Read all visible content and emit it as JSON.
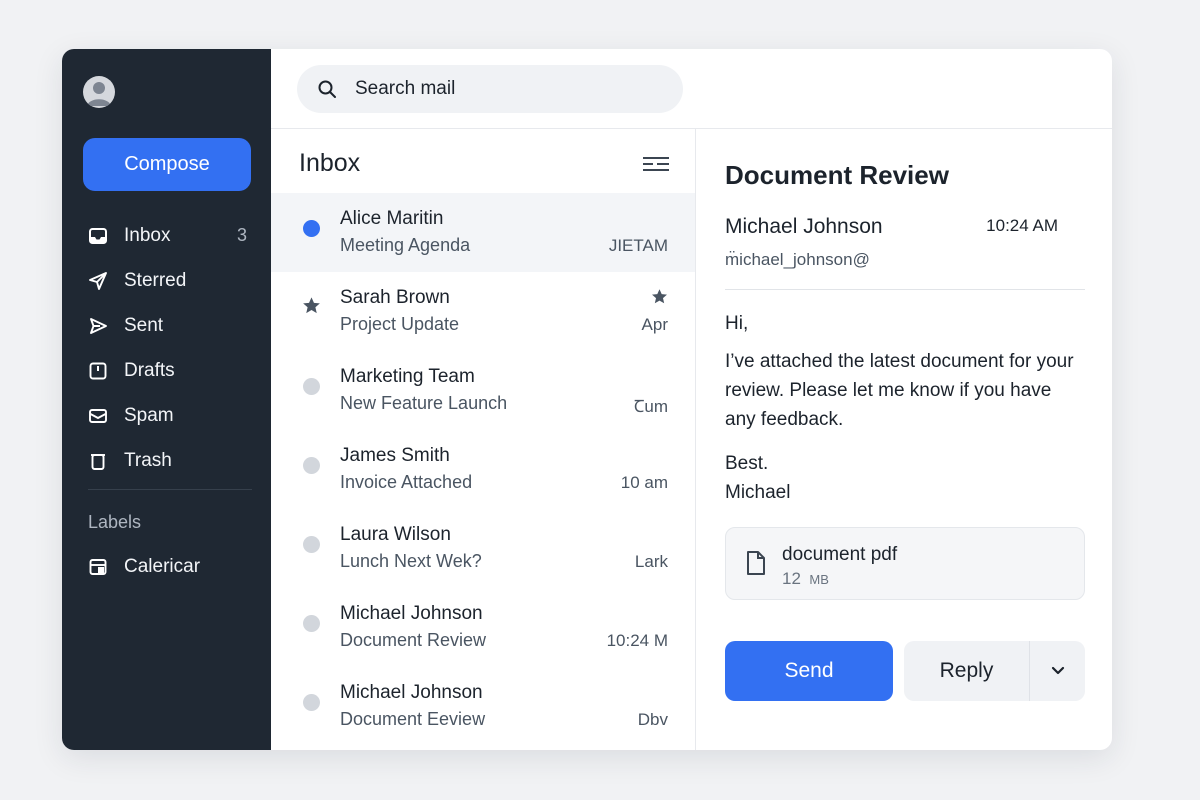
{
  "colors": {
    "accent": "#3370f2",
    "sidebar_bg": "#1f2833",
    "unread_dot": "#3370f2",
    "read_dot": "#d2d6dc"
  },
  "sidebar": {
    "compose_label": "Compose",
    "nav": [
      {
        "label": "Inbox",
        "icon": "inbox-icon",
        "count": "3"
      },
      {
        "label": "Sterred",
        "icon": "send-plane-icon"
      },
      {
        "label": "Sent",
        "icon": "sent-arrow-icon"
      },
      {
        "label": "Drafts",
        "icon": "drafts-icon"
      },
      {
        "label": "Spam",
        "icon": "envelope-icon"
      },
      {
        "label": "Trash",
        "icon": "trash-icon"
      }
    ],
    "labels_heading": "Labels",
    "labels": [
      {
        "label": "Calericar",
        "icon": "calendar-icon"
      }
    ]
  },
  "search": {
    "placeholder": "Search mail"
  },
  "inbox": {
    "title": "Inbox",
    "messages": [
      {
        "sender": "Alice Maritin",
        "subject": "Meeting Agenda",
        "date": "JIETAM",
        "marker": "unread"
      },
      {
        "sender": "Sarah Brown",
        "subject": "Project Update",
        "date": "Apr",
        "marker": "star"
      },
      {
        "sender": "Marketing Team",
        "subject": "New Feature Launch",
        "date": "Ꞇum",
        "marker": "read"
      },
      {
        "sender": "James Smith",
        "subject": "Invoice Attached",
        "date": "10 am",
        "marker": "read"
      },
      {
        "sender": "Laura Wilson",
        "subject": "Lunch Next Wek?",
        "date": "Lark",
        "marker": "read"
      },
      {
        "sender": "Michael Johnson",
        "subject": "Document Review",
        "date": "10:24 M",
        "marker": "read"
      },
      {
        "sender": "Michael Johnson",
        "subject": "Document Eeview",
        "date": "Dbv",
        "marker": "read"
      }
    ]
  },
  "message": {
    "title": "Document Review",
    "from_name": "Michael Johnson",
    "time": "10:24 AM",
    "from_email": "m̈ichael_johnson@",
    "greeting": "Hi,",
    "body": "I’ve attached the latest document for your review. Please let me know if you have any feedback.",
    "signoff": "Best.",
    "signature": "Michael",
    "attachment": {
      "name": "document pdf",
      "size_num": "12",
      "size_unit": "MB"
    },
    "send_label": "Send",
    "reply_label": "Reply"
  }
}
